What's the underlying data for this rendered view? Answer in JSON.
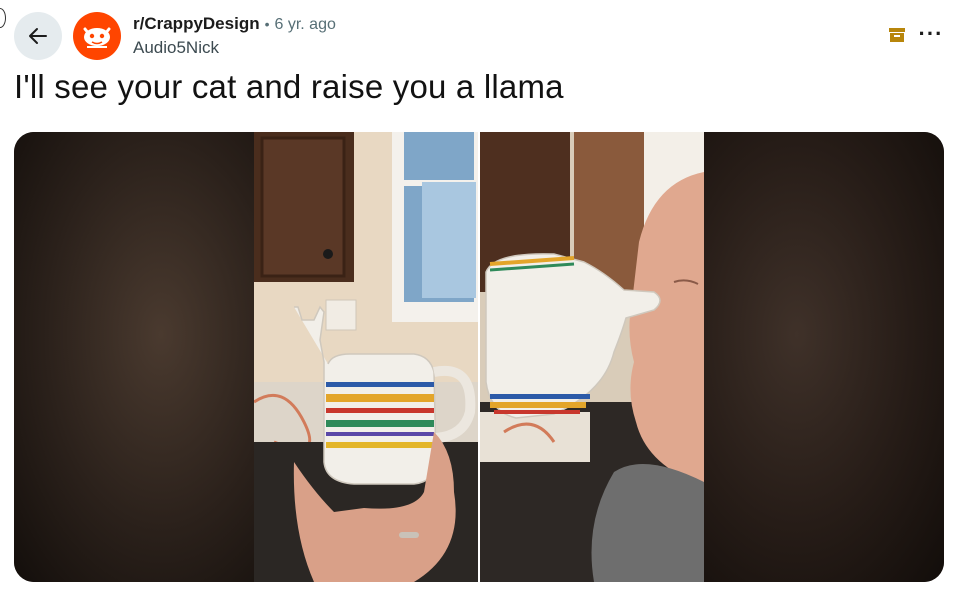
{
  "header": {
    "subreddit": "r/CrappyDesign",
    "separator": "•",
    "time": "6 yr. ago",
    "author": "Audio5Nick"
  },
  "post": {
    "title": "I'll see your cat and raise you a llama"
  },
  "icons": {
    "back": "arrow-left-icon",
    "avatar": "subreddit-avatar-icon",
    "archive": "archive-icon",
    "more": "more-horizontal-icon"
  },
  "colors": {
    "avatar_bg": "#ff4500",
    "archive_icon": "#b8860b",
    "back_button_bg": "#e5ebee"
  }
}
